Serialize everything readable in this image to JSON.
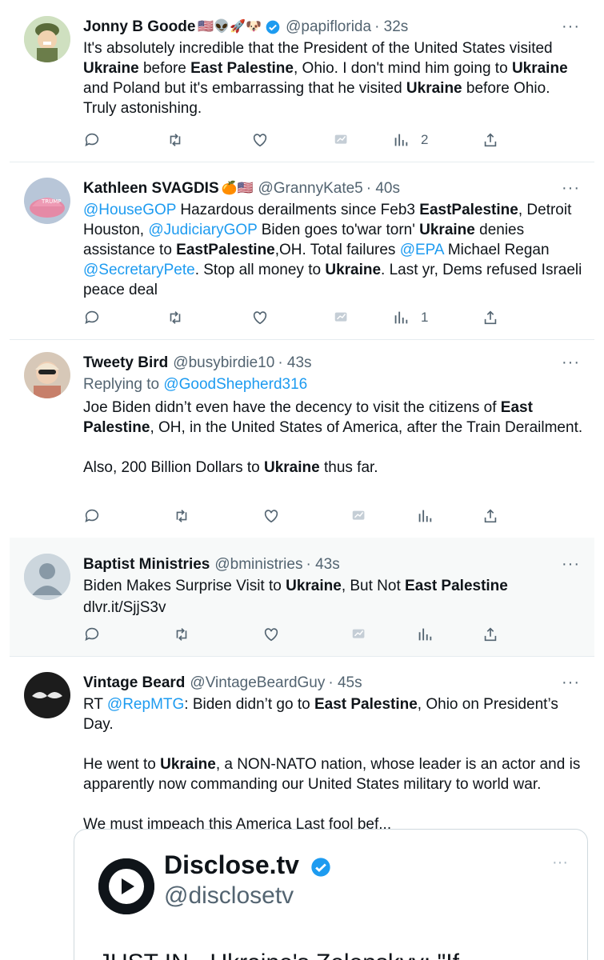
{
  "tweets": [
    {
      "name": "Jonny B Goode",
      "emojis": "🇺🇸👽🚀🐶",
      "handle": "@papiflorida",
      "time": "· 32s",
      "text_p1": [
        {
          "t": "It's absolutely incredible that the President of the United States visited "
        },
        {
          "t": "Ukraine",
          "b": true
        },
        {
          "t": " before "
        },
        {
          "t": "East Palestine",
          "b": true
        },
        {
          "t": ", Ohio. I don't mind him going to "
        },
        {
          "t": "Ukraine",
          "b": true
        },
        {
          "t": " and Poland but it's embarrassing that he visited "
        },
        {
          "t": "Ukraine",
          "b": true
        },
        {
          "t": " before Ohio. Truly astonishing."
        }
      ],
      "views": "2"
    },
    {
      "name": "Kathleen SVAGDIS",
      "emojis": "🍊🇺🇸",
      "handle": "@GrannyKate5",
      "time": "· 40s",
      "text_p1": [
        {
          "t": "@HouseGOP",
          "l": true
        },
        {
          "t": " Hazardous derailments since Feb3 "
        },
        {
          "t": "EastPalestine",
          "b": true
        },
        {
          "t": ", Detroit Houston, "
        },
        {
          "t": "@JudiciaryGOP",
          "l": true
        },
        {
          "t": " Biden goes to'war torn' "
        },
        {
          "t": "Ukraine",
          "b": true
        },
        {
          "t": " denies assistance to "
        },
        {
          "t": "EastPalestine",
          "b": true
        },
        {
          "t": ",OH. Total failures "
        },
        {
          "t": "@EPA",
          "l": true
        },
        {
          "t": " Michael Regan "
        },
        {
          "t": "@SecretaryPete",
          "l": true
        },
        {
          "t": ". Stop all money to "
        },
        {
          "t": "Ukraine",
          "b": true
        },
        {
          "t": ". Last yr, Dems refused Israeli peace deal"
        }
      ],
      "views": "1"
    },
    {
      "name": "Tweety Bird",
      "handle": "@busybirdie10",
      "time": "· 43s",
      "replying_prefix": "Replying to ",
      "replying_to": "@GoodShepherd316",
      "text_p1": [
        {
          "t": "Joe Biden didn’t even have the decency to visit the citizens of "
        },
        {
          "t": "East Palestine",
          "b": true
        },
        {
          "t": ", OH, in the United States of America, after the Train Derailment."
        }
      ],
      "text_p2": [
        {
          "t": "Also, 200 Billion Dollars to "
        },
        {
          "t": "Ukraine",
          "b": true
        },
        {
          "t": " thus far."
        }
      ]
    },
    {
      "name": "Baptist Ministries",
      "handle": "@bministries",
      "time": "· 43s",
      "text_p1": [
        {
          "t": "Biden Makes Surprise Visit to "
        },
        {
          "t": "Ukraine",
          "b": true
        },
        {
          "t": ", But Not "
        },
        {
          "t": "East Palestine",
          "b": true
        }
      ],
      "link": "dlvr.it/SjjS3v"
    },
    {
      "name": "Vintage Beard",
      "handle": "@VintageBeardGuy",
      "time": "· 45s",
      "text_p1": [
        {
          "t": "RT "
        },
        {
          "t": "@RepMTG",
          "l": true
        },
        {
          "t": ": Biden didn’t go to "
        },
        {
          "t": "East Palestine",
          "b": true
        },
        {
          "t": ", Ohio on President’s Day."
        }
      ],
      "text_p2": [
        {
          "t": "He went to "
        },
        {
          "t": "Ukraine",
          "b": true
        },
        {
          "t": ", a NON-NATO nation, whose leader is an actor and is apparently now commanding our United States military to world war."
        }
      ],
      "text_p3": [
        {
          "t": "We must impeach this America Last fool bef..."
        }
      ]
    }
  ],
  "more_label": "···",
  "card": {
    "name": "Disclose.tv",
    "handle": "@disclosetv",
    "text": "JUST IN - Ukraine's Zelenskyy: \"If",
    "more": "···"
  },
  "colors": {
    "link": "#1d9bf0",
    "muted": "#536471",
    "highlight_bg": "#f7f9f9"
  },
  "icons": [
    "reply-icon",
    "retweet-icon",
    "like-icon",
    "analytics-icon",
    "views-icon",
    "share-icon",
    "verified-icon",
    "more-icon"
  ]
}
